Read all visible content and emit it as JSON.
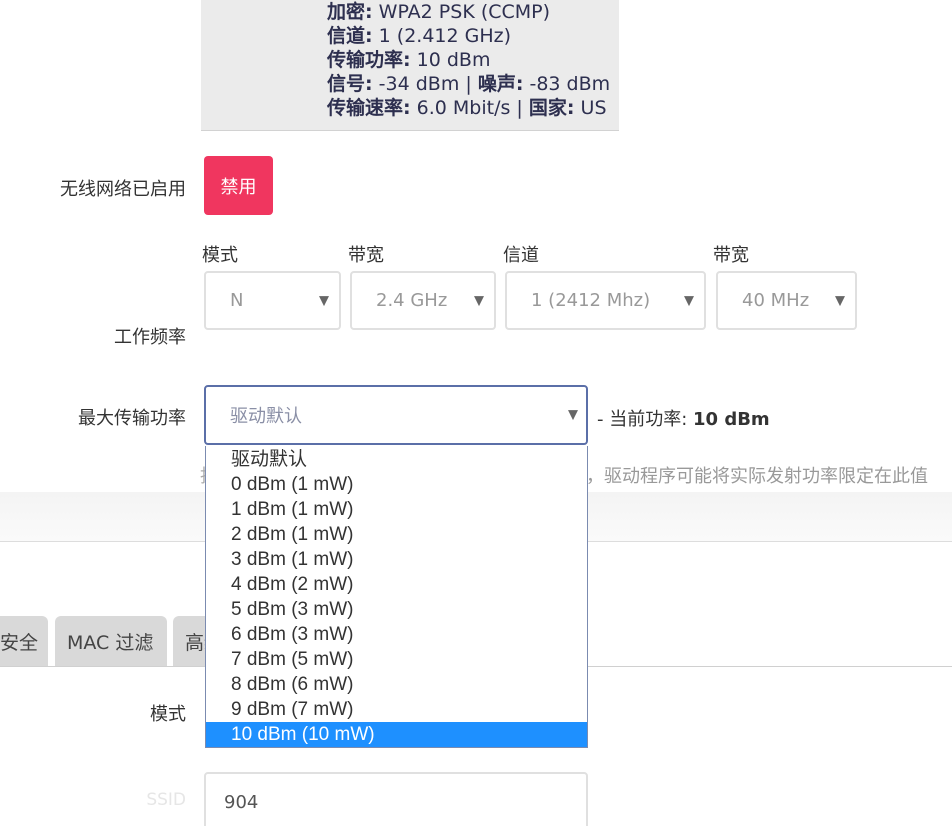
{
  "info": {
    "lines": [
      {
        "label": "加密:",
        "value": "WPA2 PSK (CCMP)"
      },
      {
        "label": "信道:",
        "value": "1 (2.412 GHz)"
      },
      {
        "label": "传输功率:",
        "value": "10 dBm"
      },
      {
        "label": "信号:",
        "value": "-34 dBm | ",
        "label2": "噪声:",
        "value2": "-83 dBm"
      },
      {
        "label": "传输速率:",
        "value": "6.0 Mbit/s | ",
        "label2": "国家:",
        "value2": "US"
      }
    ]
  },
  "wireless": {
    "label": "无线网络已启用",
    "button": "禁用"
  },
  "frequency": {
    "label": "工作频率",
    "mode_label": "模式",
    "mode_value": "N",
    "band_label": "带宽",
    "band_value": "2.4 GHz",
    "channel_label": "信道",
    "channel_value": "1 (2412 Mhz)",
    "width_label": "带宽",
    "width_value": "40 MHz"
  },
  "txpower": {
    "label": "最大传输功率",
    "selected": "驱动默认",
    "note_prefix": "- 当前功率:",
    "note_value": "10 dBm",
    "desc_left": "指",
    "desc": "，驱动程序可能将实际发射功率限定在此值",
    "options": [
      "驱动默认",
      "0 dBm (1 mW)",
      "1 dBm (1 mW)",
      "2 dBm (1 mW)",
      "3 dBm (1 mW)",
      "4 dBm (2 mW)",
      "5 dBm (3 mW)",
      "6 dBm (3 mW)",
      "7 dBm (5 mW)",
      "8 dBm (6 mW)",
      "9 dBm (7 mW)",
      "10 dBm (10 mW)"
    ],
    "highlighted": "10 dBm (10 mW)"
  },
  "tabs": [
    {
      "label": "安全"
    },
    {
      "label": "MAC 过滤"
    },
    {
      "label": "高级设置"
    }
  ],
  "iface": {
    "mode_label": "模式",
    "ssid_label": "SSID",
    "ssid_value": "904"
  },
  "colors": {
    "disable_button": "#f0365f",
    "highlight": "#1e90ff"
  }
}
